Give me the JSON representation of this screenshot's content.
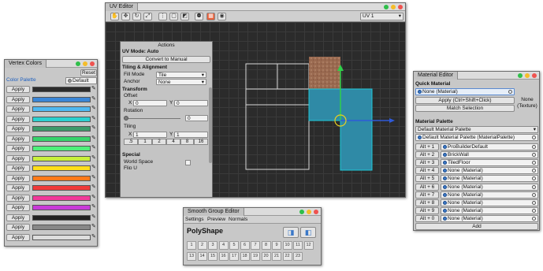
{
  "vertex_colors": {
    "title": "Vertex Colors",
    "reset_label": "Reset",
    "palette_label": "Color Palette",
    "palette_value": "Default",
    "apply_label": "Apply",
    "swatches": [
      "#2b2b2b",
      "#3a86d6",
      "#4fb8f0",
      "#2bd0cf",
      "#3d9a6a",
      "#37d36b",
      "#4ef07a",
      "#c8ef3a",
      "#ffde1a",
      "#ff7a1a",
      "#ef3a3a",
      "#f03a9a",
      "#c83ad8",
      "#222222",
      "#888888",
      "#dddddd"
    ]
  },
  "uv_editor": {
    "title": "UV Editor",
    "channel_value": "UV 1"
  },
  "actions_panel": {
    "title": "Actions",
    "mode_label": "UV Mode: Auto",
    "convert_label": "Convert to Manual",
    "tiling_alignment_header": "Tiling & Alignment",
    "fill_mode_label": "Fill Mode",
    "fill_mode_value": "Tile",
    "anchor_label": "Anchor",
    "anchor_value": "None",
    "transform_header": "Transform",
    "offset_label": "Offset",
    "offset_x_label": "X",
    "offset_x": "0",
    "offset_y_label": "Y",
    "offset_y": "0",
    "rotation_label": "Rotation",
    "rotation_value": "0",
    "tiling_label": "Tiling",
    "tiling_x_label": "X",
    "tiling_x": "1",
    "tiling_y_label": "Y",
    "tiling_y": "1",
    "tiling_presets": [
      ".5",
      "1",
      "2",
      "4",
      "8",
      "16"
    ],
    "special_header": "Special",
    "world_space_label": "World Space",
    "flip_label": "Flip U"
  },
  "smooth_group": {
    "title": "Smooth Group Editor",
    "tabs": [
      "Settings",
      "Preview",
      "Normals"
    ],
    "object_name": "PolyShape",
    "groups": [
      "1",
      "2",
      "3",
      "4",
      "5",
      "6",
      "7",
      "8",
      "9",
      "10",
      "11",
      "12",
      "13",
      "14",
      "15",
      "16",
      "17",
      "18",
      "19",
      "20",
      "21",
      "22",
      "23"
    ]
  },
  "material_editor": {
    "title": "Material Editor",
    "quick_material_header": "Quick Material",
    "quick_material_value": "None (Material)",
    "apply_label": "Apply (Ctrl+Shift+Click)",
    "match_label": "Match Selection",
    "preview_label": "None (Texture)",
    "palette_header": "Material Palette",
    "palette_value": "Default Material Palette",
    "palette_asset": "Default Material Palette (MaterialPalette)",
    "slots": [
      {
        "key": "Alt + 1",
        "material": "ProBuilderDefault"
      },
      {
        "key": "Alt + 2",
        "material": "BrickWall"
      },
      {
        "key": "Alt + 3",
        "material": "TiledFloor"
      },
      {
        "key": "Alt + 4",
        "material": "None (Material)"
      },
      {
        "key": "Alt + 5",
        "material": "None (Material)"
      },
      {
        "key": "Alt + 6",
        "material": "None (Material)"
      },
      {
        "key": "Alt + 7",
        "material": "None (Material)"
      },
      {
        "key": "Alt + 8",
        "material": "None (Material)"
      },
      {
        "key": "Alt + 9",
        "material": "None (Material)"
      },
      {
        "key": "Alt + 0",
        "material": "None (Material)"
      }
    ],
    "add_label": "Add"
  }
}
